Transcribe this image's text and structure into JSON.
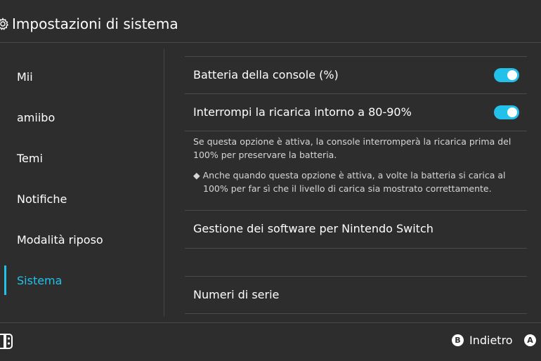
{
  "header": {
    "title": "Impostazioni di sistema",
    "icon": "gear-icon"
  },
  "sidebar": {
    "items": [
      {
        "label": "Mii"
      },
      {
        "label": "amiibo"
      },
      {
        "label": "Temi"
      },
      {
        "label": "Notifiche"
      },
      {
        "label": "Modalità riposo"
      },
      {
        "label": "Sistema",
        "active": true
      }
    ]
  },
  "main": {
    "battery_percent": {
      "label": "Batteria della console (%)",
      "toggle_on": true
    },
    "stop_charging": {
      "label": "Interrompi la ricarica intorno a 80-90%",
      "toggle_on": true
    },
    "description": "Se questa opzione è attiva, la console interromperà la ricarica prima del 100% per preservare la batteria.",
    "note_bullet": "◆",
    "note": "Anche quando questa opzione è attiva, a volte la batteria si carica al 100% per far sì che il livello di carica sia mostrato correttamente.",
    "software_management": {
      "label": "Gestione dei software per Nintendo Switch"
    },
    "serial_numbers": {
      "label": "Numeri di serie"
    }
  },
  "footer": {
    "back_button_glyph": "B",
    "back_label": "Indietro",
    "a_button_glyph": "A"
  },
  "colors": {
    "accent": "#22c1ea",
    "background": "#2d2d2d",
    "divider": "#4a4a4a"
  }
}
